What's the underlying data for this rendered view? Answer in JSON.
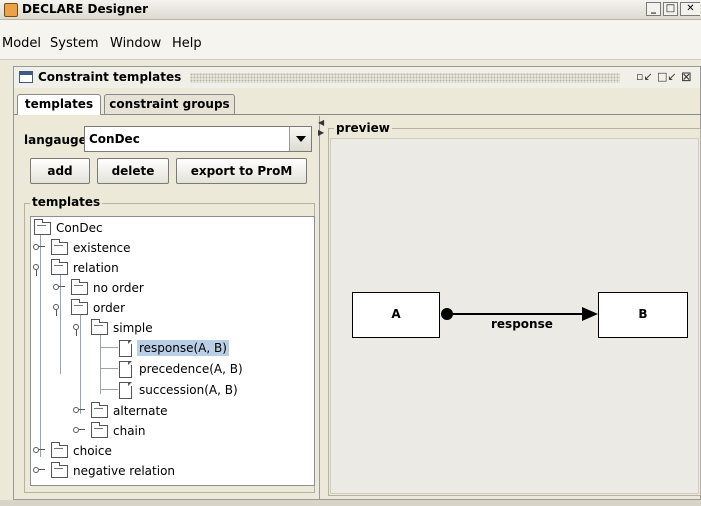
{
  "window": {
    "title": "DECLARE Designer",
    "controls": [
      "minimize-icon",
      "maximize-icon",
      "close-icon"
    ]
  },
  "menubar": {
    "items": [
      "Model",
      "System",
      "Window",
      "Help"
    ]
  },
  "internal_frame": {
    "title": "Constraint templates",
    "controls": [
      "restore-icon",
      "maximize-icon",
      "close-icon"
    ]
  },
  "tabs": [
    {
      "label": "templates",
      "selected": true
    },
    {
      "label": "constraint groups",
      "selected": false
    }
  ],
  "language": {
    "label": "langauge",
    "value": "ConDec"
  },
  "buttons": {
    "add": "add",
    "delete": "delete",
    "export": "export to ProM"
  },
  "templates_group": {
    "label": "templates",
    "tree": [
      {
        "label": "ConDec",
        "type": "folder",
        "depth": 0
      },
      {
        "label": "existence",
        "type": "folder",
        "depth": 1,
        "expanded": false
      },
      {
        "label": "relation",
        "type": "folder",
        "depth": 1,
        "expanded": true
      },
      {
        "label": "no order",
        "type": "folder",
        "depth": 2,
        "expanded": false
      },
      {
        "label": "order",
        "type": "folder",
        "depth": 2,
        "expanded": true
      },
      {
        "label": "simple",
        "type": "folder",
        "depth": 3,
        "expanded": true
      },
      {
        "label": "response(A, B)",
        "type": "leaf",
        "depth": 4,
        "selected": true
      },
      {
        "label": "precedence(A, B)",
        "type": "leaf",
        "depth": 4
      },
      {
        "label": "succession(A, B)",
        "type": "leaf",
        "depth": 4
      },
      {
        "label": "alternate",
        "type": "folder",
        "depth": 3,
        "expanded": false
      },
      {
        "label": "chain",
        "type": "folder",
        "depth": 3,
        "expanded": false
      },
      {
        "label": "choice",
        "type": "folder",
        "depth": 1,
        "expanded": false
      },
      {
        "label": "negative relation",
        "type": "folder",
        "depth": 1,
        "expanded": false
      }
    ]
  },
  "preview": {
    "label": "preview",
    "source": "A",
    "target": "B",
    "relation": "response"
  },
  "colors": {
    "background": "#ece9d8",
    "selection": "#b8cfe5"
  }
}
